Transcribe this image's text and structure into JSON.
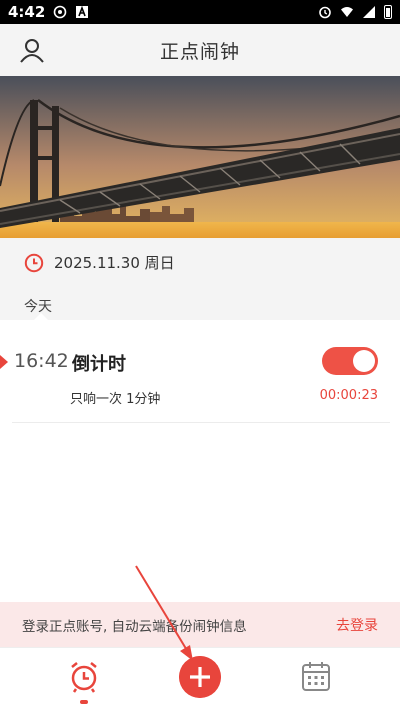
{
  "status_bar": {
    "time": "4:42"
  },
  "app": {
    "title": "正点闹钟"
  },
  "date": {
    "text": "2025.11.30 周日",
    "day_label": "今天"
  },
  "alarm": {
    "time": "16:42",
    "name": "倒计时",
    "repeat": "只响一次 1分钟",
    "countdown": "00:00:23",
    "enabled": true
  },
  "banner": {
    "text": "登录正点账号, 自动云端备份闹钟信息",
    "link": "去登录"
  },
  "colors": {
    "accent": "#e8453c",
    "toggle_on": "#ee5246",
    "banner_bg": "#fbe8e8"
  },
  "icons": {
    "status": [
      "photo-icon",
      "a-icon",
      "alarm-icon",
      "wifi-icon",
      "signal-icon",
      "battery-icon"
    ],
    "appbar": "user-icon",
    "date": "clock-icon",
    "tabs": [
      "alarm-clock-icon",
      "add-icon",
      "calendar-icon"
    ]
  }
}
